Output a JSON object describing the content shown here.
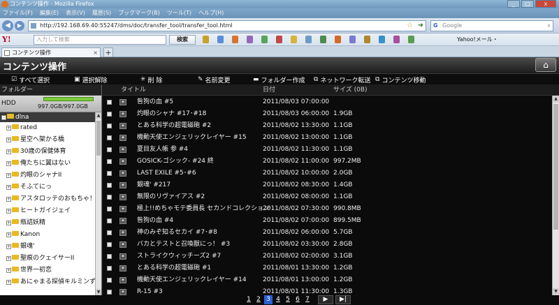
{
  "browser": {
    "window_title": "コンテンツ操作 - Mozilla Firefox",
    "menu": [
      "ファイル(F)",
      "編集(E)",
      "表示(V)",
      "履歴(S)",
      "ブックマーク(B)",
      "ツール(T)",
      "ヘルプ(H)"
    ],
    "url": "http://192.168.69.40:55247/dms/doc/transfer_tool/transfer_tool.html",
    "search_placeholder": "Google",
    "yahoo_input_placeholder": "入力して検索",
    "yahoo_search_label": "検索",
    "yahoo_mail_label": "Yahoo!メール・",
    "tab_title": "コンテンツ操作",
    "new_tab_label": "+"
  },
  "app": {
    "title": "コンテンツ操作",
    "toolbar": [
      {
        "label": "すべて選択",
        "icon": "check-icon"
      },
      {
        "label": "選択解除",
        "icon": "square-icon"
      },
      {
        "label": "削 除",
        "icon": "delete-icon"
      },
      {
        "label": "名前変更",
        "icon": "pencil-icon"
      },
      {
        "label": "フォルダー作成",
        "icon": "folder-icon"
      },
      {
        "label": "ネットワーク転送",
        "icon": "network-icon"
      },
      {
        "label": "コンテンツ移動",
        "icon": "move-icon"
      }
    ]
  },
  "sidebar": {
    "header": "フォルダー",
    "hdd_label": "HDD",
    "hdd_capacity": "997.0GB/997.0GB",
    "hdd_fill": 1.0,
    "root": "dlna",
    "folders": [
      "rated",
      "星空へ架かる橋",
      "30歳の保健体育",
      "俺たちに翼はない",
      "灼眼のシャナII",
      "そふてにっ",
      "アスタロッテのおもちゃ！",
      "ヒートガイジェイ",
      "瓶詰妖精",
      "Kanon",
      "銀魂'",
      "聖痕のクェイサーII",
      "世界一初恋",
      "あにゃまる探偵キルミンずぅ"
    ]
  },
  "list": {
    "headers": {
      "title": "タイトル",
      "date": "日付",
      "size": "サイズ (0B)"
    },
    "rows": [
      {
        "title": "咎狗の血 #5",
        "date": "2011/08/03 07:00:00",
        "size": ""
      },
      {
        "title": "灼眼のシャナ #17･#18",
        "date": "2011/08/03 06:00:00",
        "size": "1.9GB"
      },
      {
        "title": "とある科学の超電磁砲 #2",
        "date": "2011/08/02 13:30:00",
        "size": "1.1GB"
      },
      {
        "title": "機動天使エンジェリックレイヤー #15",
        "date": "2011/08/02 13:00:00",
        "size": "1.1GB"
      },
      {
        "title": "夏目友人帳 参 #4",
        "date": "2011/08/02 11:30:00",
        "size": "1.1GB"
      },
      {
        "title": "GOSICK-ゴシック- #24 終",
        "date": "2011/08/02 11:00:00",
        "size": "997.2MB"
      },
      {
        "title": "LAST EXILE #5･#6",
        "date": "2011/08/02 10:00:00",
        "size": "2.0GB"
      },
      {
        "title": "銀魂' #217",
        "date": "2011/08/02 08:30:00",
        "size": "1.4GB"
      },
      {
        "title": "無限のリヴァイアス #2",
        "date": "2011/08/02 08:00:00",
        "size": "1.1GB"
      },
      {
        "title": "極上!!めちゃモテ委員長 セカンドコレクション",
        "date": "2011/08/02 07:30:00",
        "size": "990.8MB"
      },
      {
        "title": "咎狗の血 #4",
        "date": "2011/08/02 07:00:00",
        "size": "899.5MB"
      },
      {
        "title": "神のみぞ知るセカイ #7･#8",
        "date": "2011/08/02 06:00:00",
        "size": "5.7GB"
      },
      {
        "title": "バカとテストと召喚獣にっ！ #3",
        "date": "2011/08/02 03:30:00",
        "size": "2.8GB"
      },
      {
        "title": "ストライクウィッチーズ2 #7",
        "date": "2011/08/02 02:00:00",
        "size": "3.1GB"
      },
      {
        "title": "とある科学の超電磁砲 #1",
        "date": "2011/08/01 13:30:00",
        "size": "1.2GB"
      },
      {
        "title": "機動天使エンジェリックレイヤー #14",
        "date": "2011/08/01 13:00:00",
        "size": "1.2GB"
      },
      {
        "title": "R-15 #3",
        "date": "2011/08/01 11:30:00",
        "size": "1.3GB"
      }
    ]
  },
  "pager": {
    "pages": [
      "1",
      "2",
      "3",
      "4",
      "5",
      "6",
      "7"
    ],
    "current": "3",
    "next_label": "▶",
    "last_label": "▶|"
  }
}
